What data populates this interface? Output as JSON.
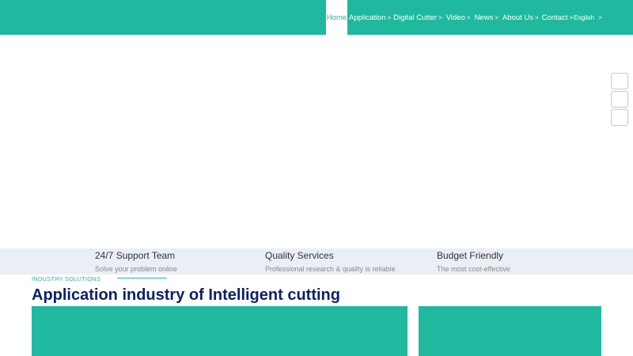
{
  "header": {
    "nav": [
      {
        "label": "Home",
        "active": true
      },
      {
        "label": "Application",
        "caret": ">"
      },
      {
        "label": "Digital Cutter",
        "caret": ">"
      },
      {
        "label": "Video",
        "caret": ">"
      },
      {
        "label": "News",
        "caret": ">"
      },
      {
        "label": "About Us",
        "caret": ">"
      },
      {
        "label": "Contact",
        "caret": ">"
      }
    ],
    "language": {
      "label": "English",
      "caret": ">"
    }
  },
  "features": [
    {
      "title": "24/7 Support Team",
      "subtitle": "Solve your problem online"
    },
    {
      "title": "Quality Services",
      "subtitle": "Professional research & quality is reliable"
    },
    {
      "title": "Budget Friendly",
      "subtitle": "The most cost-effective"
    }
  ],
  "section": {
    "label": "INDUSTRY SOLUTIONS",
    "title": "Application industry of Intelligent cutting"
  },
  "colors": {
    "brand": "#20b99f",
    "title": "#0d1f6b",
    "strip": "#eaeff5"
  }
}
